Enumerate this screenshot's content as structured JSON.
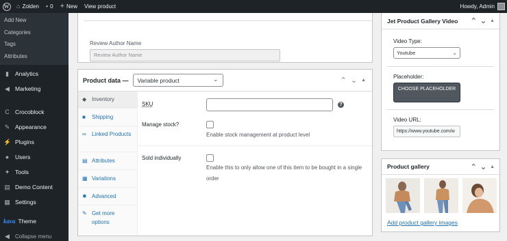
{
  "adminbar": {
    "site_name": "Zolden",
    "comments_count": "0",
    "new_label": "New",
    "view_label": "View product",
    "howdy": "Howdy, Admin"
  },
  "sidebar": {
    "submenu": [
      "Add New",
      "Categories",
      "Tags",
      "Attributes"
    ],
    "items": [
      {
        "label": "Analytics",
        "icon": "bar-chart-icon"
      },
      {
        "label": "Marketing",
        "icon": "megaphone-icon"
      },
      {
        "label": "Crocoblock",
        "icon": "crocoblock-icon"
      },
      {
        "label": "Appearance",
        "icon": "paintbrush-icon"
      },
      {
        "label": "Plugins",
        "icon": "plug-icon"
      },
      {
        "label": "Users",
        "icon": "user-icon"
      },
      {
        "label": "Tools",
        "icon": "wrench-icon"
      },
      {
        "label": "Demo Content",
        "icon": "download-icon"
      },
      {
        "label": "Settings",
        "icon": "settings-icon"
      },
      {
        "label": "Theme",
        "icon": "kava-logo"
      }
    ],
    "kava_mark": "kava",
    "collapse_label": "Collapse menu"
  },
  "review": {
    "label": "Review Author Name",
    "value": "Review Author Name"
  },
  "product_data": {
    "title": "Product data —",
    "type_selected": "Variable product",
    "tabs": [
      {
        "label": "Inventory",
        "icon": "inventory-icon",
        "active": true
      },
      {
        "label": "Shipping",
        "icon": "truck-icon",
        "active": false
      },
      {
        "label": "Linked Products",
        "icon": "link-icon",
        "active": false
      },
      {
        "label": "Attributes",
        "icon": "list-icon",
        "active": false
      },
      {
        "label": "Variations",
        "icon": "grid-icon",
        "active": false
      },
      {
        "label": "Advanced",
        "icon": "gear-icon",
        "active": false
      },
      {
        "label": "Get more options",
        "icon": "plugin-icon",
        "active": false
      }
    ],
    "sku_label": "SKU",
    "sku_value": "",
    "manage_stock_label": "Manage stock?",
    "manage_stock_desc": "Enable stock management at product level",
    "sold_individually_label": "Sold individually",
    "sold_individually_desc": "Enable this to only allow one of this item to be bought in a single order"
  },
  "gallery_video": {
    "title": "Jet Product Gallery Video",
    "video_type_label": "Video Type:",
    "video_type_value": "Youtube",
    "placeholder_label": "Placeholder:",
    "choose_button": "CHOOSE PLACEHOLDER",
    "video_url_label": "Video URL:",
    "video_url_value": "https://www.youtube.com/w"
  },
  "product_gallery": {
    "title": "Product gallery",
    "add_link": "Add product gallery images"
  },
  "colors": {
    "adminbar_bg": "#1d2327",
    "link": "#2271b1",
    "button_dark": "#50575e"
  }
}
